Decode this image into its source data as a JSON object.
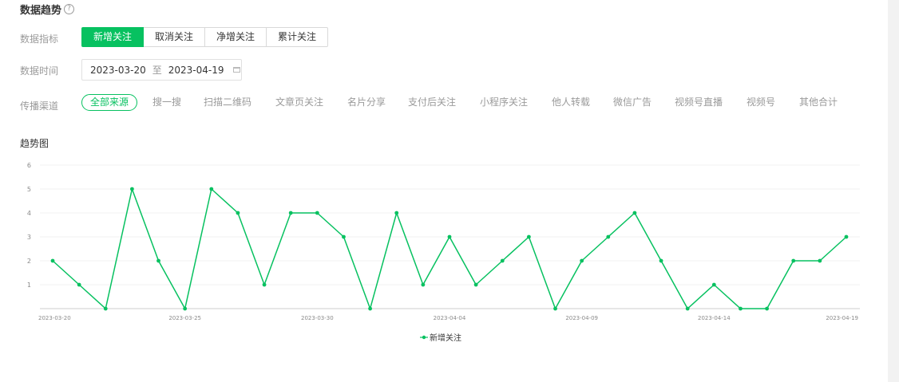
{
  "header": {
    "title": "数据趋势",
    "help_glyph": "?"
  },
  "filters": {
    "metric_label": "数据指标",
    "metrics": [
      "新增关注",
      "取消关注",
      "净增关注",
      "累计关注"
    ],
    "active_metric": 0,
    "time_label": "数据时间",
    "date_start": "2023-03-20",
    "date_sep": "至",
    "date_end": "2023-04-19",
    "channel_label": "传播渠道",
    "channels": [
      "全部来源",
      "搜一搜",
      "扫描二维码",
      "文章页关注",
      "名片分享",
      "支付后关注",
      "小程序关注",
      "他人转载",
      "微信广告",
      "视频号直播",
      "视频号",
      "其他合计"
    ],
    "active_channel": 0
  },
  "trend_title": "趋势图",
  "colors": {
    "accent": "#07c160",
    "grid": "#f0f0f0",
    "axis": "#cccccc"
  },
  "chart_data": {
    "type": "line",
    "x": [
      "2023-03-20",
      "2023-03-21",
      "2023-03-22",
      "2023-03-23",
      "2023-03-24",
      "2023-03-25",
      "2023-03-26",
      "2023-03-27",
      "2023-03-28",
      "2023-03-29",
      "2023-03-30",
      "2023-03-31",
      "2023-04-01",
      "2023-04-02",
      "2023-04-03",
      "2023-04-04",
      "2023-04-05",
      "2023-04-06",
      "2023-04-07",
      "2023-04-08",
      "2023-04-09",
      "2023-04-10",
      "2023-04-11",
      "2023-04-12",
      "2023-04-13",
      "2023-04-14",
      "2023-04-15",
      "2023-04-16",
      "2023-04-17",
      "2023-04-18",
      "2023-04-19"
    ],
    "series": [
      {
        "name": "新增关注",
        "values": [
          2,
          1,
          0,
          5,
          2,
          0,
          5,
          4,
          1,
          4,
          4,
          3,
          0,
          4,
          1,
          3,
          1,
          2,
          3,
          0,
          2,
          3,
          4,
          2,
          0,
          1,
          0,
          0,
          2,
          2,
          3
        ]
      }
    ],
    "x_ticks": [
      "2023-03-20",
      "2023-03-25",
      "2023-03-30",
      "2023-04-04",
      "2023-04-09",
      "2023-04-14",
      "2023-04-19"
    ],
    "y_ticks": [
      1,
      2,
      3,
      4,
      5,
      6
    ],
    "ylim": [
      0,
      6
    ],
    "grid": true,
    "legend_position": "bottom-center"
  }
}
